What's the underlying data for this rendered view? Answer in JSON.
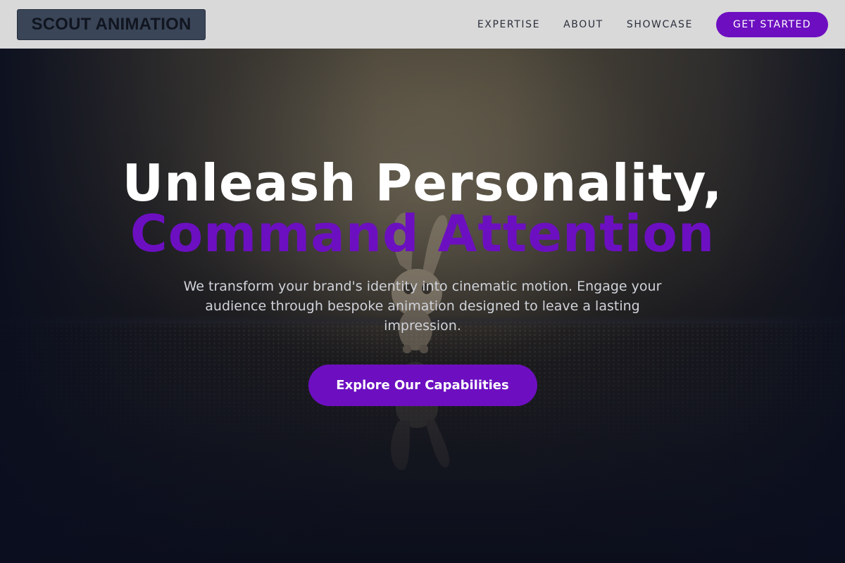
{
  "nav": {
    "logo": "SCOUT ANIMATION",
    "links": [
      "EXPERTISE",
      "ABOUT",
      "SHOWCASE"
    ],
    "cta": "GET STARTED"
  },
  "hero": {
    "headline_line1": "Unleash Personality,",
    "headline_line2": "Command Attention",
    "subtext": "We transform your brand's identity into cinematic motion. Engage your audience through bespoke animation designed to leave a lasting impression.",
    "cta": "Explore Our Capabilities",
    "background": "dark-cinematic-scene-with-bunny-figure"
  },
  "colors": {
    "accent": "#6d0fc1",
    "navbar_bg": "#d9d9da",
    "logo_bg": "#3a4558",
    "hero_text": "#ffffff",
    "subtext": "#d0d3da"
  }
}
